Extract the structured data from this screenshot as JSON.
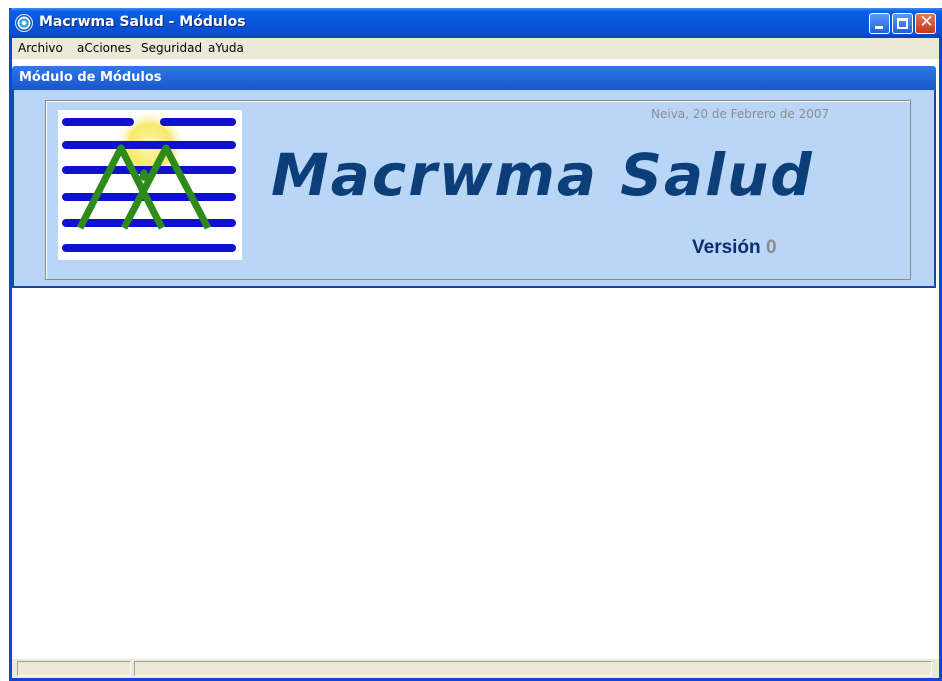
{
  "window": {
    "title": "Macrwma Salud - Módulos"
  },
  "menubar": {
    "items": [
      {
        "label": "Archivo"
      },
      {
        "label": "aCciones"
      },
      {
        "label": "Seguridad"
      },
      {
        "label": "aYuda"
      }
    ]
  },
  "module": {
    "title": "Módulo de Módulos"
  },
  "banner": {
    "date": "Neiva, 20 de Febrero de 2007",
    "app_name": "Macrwma Salud",
    "version_label": "Versión",
    "version_number": "0"
  },
  "colors": {
    "titlebar": "#0854d8",
    "banner_bg": "#b9d6f6",
    "app_name": "#0c3f7a",
    "logo_stripes": "#1010d0",
    "logo_mountains": "#2e8a1a",
    "logo_sun": "#f7e96a"
  },
  "icons": {
    "app": "macrwma-app-icon",
    "minimize": "minimize-icon",
    "maximize": "maximize-icon",
    "close": "close-icon",
    "logo": "macrwma-logo"
  }
}
